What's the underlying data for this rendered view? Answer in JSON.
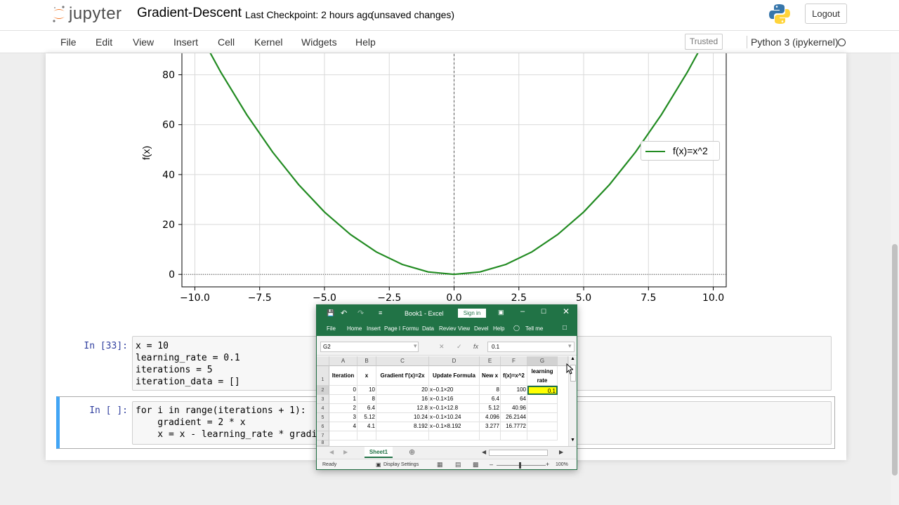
{
  "app": {
    "logo_text": "jupyter",
    "notebook_title": "Gradient-Descent",
    "checkpoint": "Last Checkpoint: 2 hours ago",
    "unsaved": "(unsaved changes)",
    "logout_label": "Logout"
  },
  "menubar": {
    "items": [
      "File",
      "Edit",
      "View",
      "Insert",
      "Cell",
      "Kernel",
      "Widgets",
      "Help"
    ],
    "trusted_label": "Trusted",
    "kernel_name": "Python 3 (ipykernel)"
  },
  "chart_data": {
    "type": "line",
    "function": "x^2",
    "series": [
      {
        "name": "f(x)=x^2",
        "color": "#228b22",
        "x": [
          -10,
          -9,
          -8,
          -7,
          -6,
          -5,
          -4,
          -3,
          -2,
          -1,
          0,
          1,
          2,
          3,
          4,
          5,
          6,
          7,
          8,
          9,
          10
        ],
        "y": [
          100,
          81,
          64,
          49,
          36,
          25,
          16,
          9,
          4,
          1,
          0,
          1,
          4,
          9,
          16,
          25,
          36,
          49,
          64,
          81,
          100
        ]
      }
    ],
    "xlim": [
      -10.5,
      10.5
    ],
    "ylim": [
      -5,
      90
    ],
    "xticks": [
      "−10.0",
      "−7.5",
      "−5.0",
      "−2.5",
      "0.0",
      "2.5",
      "5.0",
      "7.5",
      "10.0"
    ],
    "xtick_values": [
      -10,
      -7.5,
      -5,
      -2.5,
      0,
      2.5,
      5,
      7.5,
      10
    ],
    "yticks": [
      "0",
      "20",
      "40",
      "60",
      "80"
    ],
    "ytick_values": [
      0,
      20,
      40,
      60,
      80
    ],
    "ylabel": "f(x)",
    "grid": true,
    "legend_position": "right",
    "reference_lines": [
      "x=0 dashed",
      "y=0 dotted"
    ]
  },
  "cells": [
    {
      "prompt": "In [33]:",
      "lines": [
        "x = 10",
        "learning_rate = 0.1",
        "iterations = 5",
        "iteration_data = []"
      ]
    },
    {
      "prompt": "In [ ]:",
      "lines": [
        "for i in range(iterations + 1):",
        "    gradient = 2 * x",
        "    x = x - learning_rate * gradie"
      ]
    }
  ],
  "excel": {
    "title": "Book1  -  Excel",
    "signin": "Sign in",
    "tabs": [
      "File",
      "Home",
      "Insert",
      "Page I",
      "Formu",
      "Data",
      "Reviev",
      "View",
      "Devel",
      "Help",
      "Tell me"
    ],
    "name_box": "G2",
    "formula_value": "0.1",
    "columns": [
      "A",
      "B",
      "C",
      "D",
      "E",
      "F",
      "G"
    ],
    "header_row": [
      "Iteration",
      "x",
      "Gradient f'(x)=2x",
      "Update Formula",
      "New x",
      "f(x)=x^2",
      "learning rate"
    ],
    "rows": [
      [
        "0",
        "10",
        "20",
        "x−0.1×20",
        "8",
        "100",
        "0.1"
      ],
      [
        "1",
        "8",
        "16",
        "x−0.1×16",
        "6.4",
        "64",
        ""
      ],
      [
        "2",
        "6.4",
        "12.8",
        "x−0.1×12.8",
        "5.12",
        "40.96",
        ""
      ],
      [
        "3",
        "5.12",
        "10.24",
        "x−0.1×10.24",
        "4.096",
        "26.2144",
        ""
      ],
      [
        "4",
        "4.1",
        "8.192",
        "x−0.1×8.192",
        "3.277",
        "16.7772",
        ""
      ]
    ],
    "row_numbers": [
      "1",
      "2",
      "3",
      "4",
      "5",
      "6",
      "7",
      "8"
    ],
    "sheet_tab": "Sheet1",
    "status_ready": "Ready",
    "display_settings": "Display Settings",
    "zoom": "100%",
    "highlight_color": "#ffff00"
  }
}
